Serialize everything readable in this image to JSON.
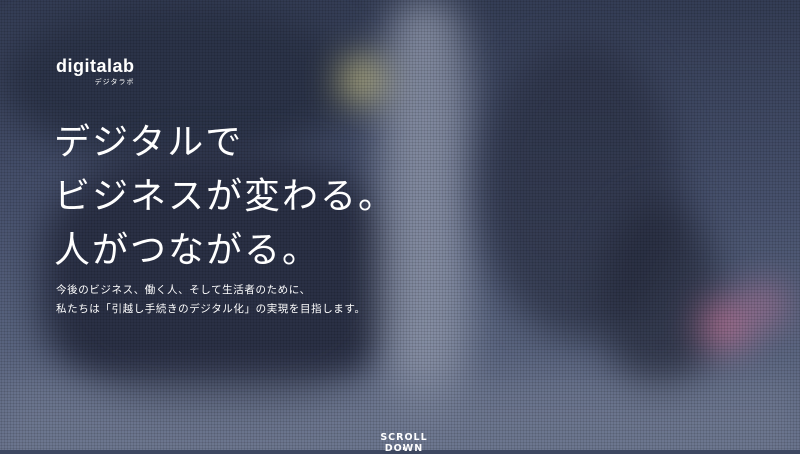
{
  "logo": {
    "main": "digitalab",
    "sub": "デジタラボ"
  },
  "headline": [
    "デジタルで",
    "ビジネスが変わる。",
    "人がつながる。"
  ],
  "lead": [
    "今後のビジネス、働く人、そして生活者のために、",
    "私たちは「引越し手続きのデジタル化」の実現を目指します。"
  ],
  "scroll": {
    "label": "SCROLL DOWN"
  },
  "colors": {
    "text": "#ffffff",
    "overlay": "#3d4760",
    "bokeh_yellow": "#d9d089",
    "bokeh_pink": "#e37aa0"
  }
}
